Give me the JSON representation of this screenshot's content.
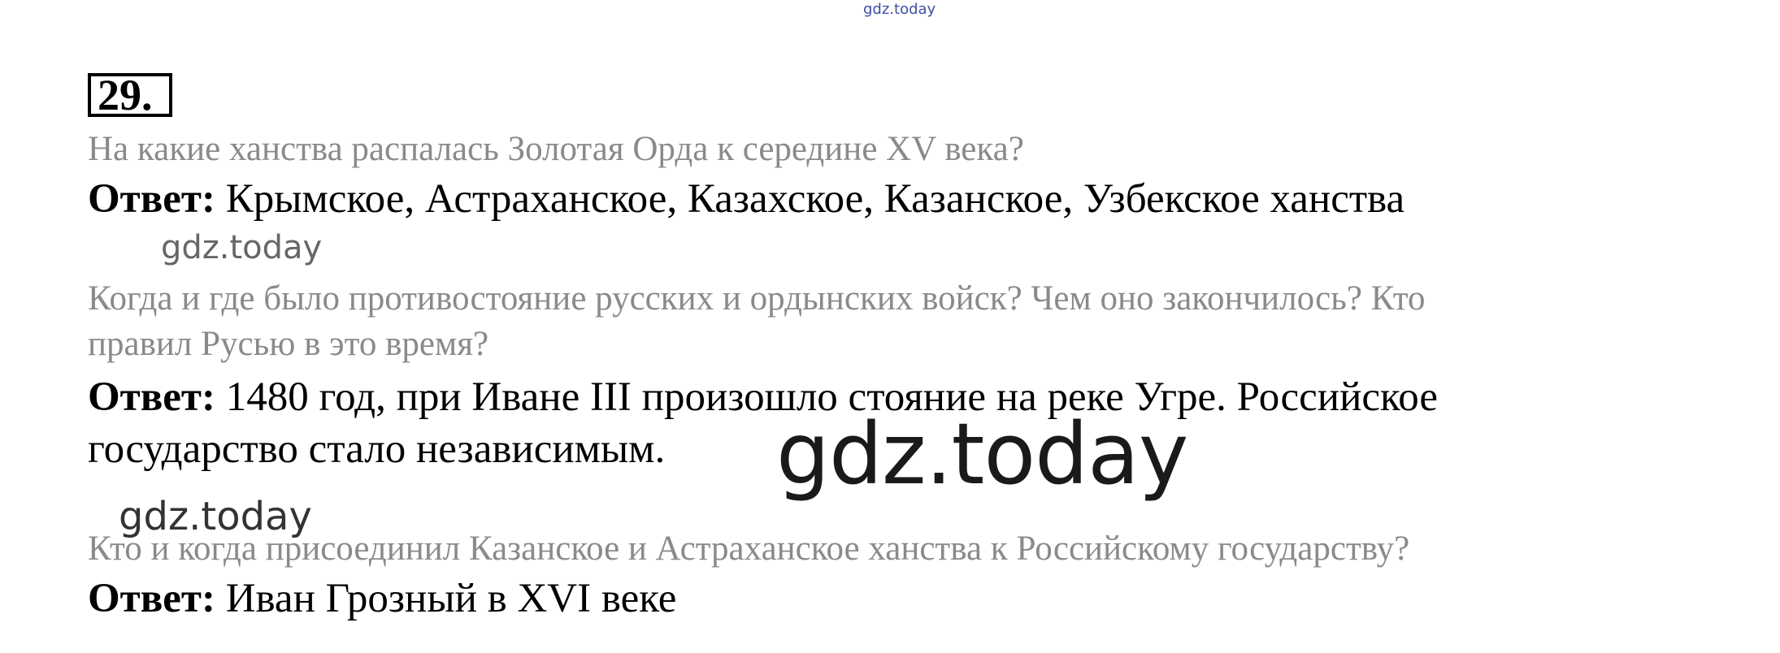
{
  "watermark_top": "gdz.today",
  "task_number": "29.",
  "questions": [
    "На какие ханства распалась Золотая Орда к середине XV века?",
    "Когда и где было противостояние русских и ордынских войск? Чем оно закончилось? Кто",
    "правил Русью в это время?",
    "Кто и когда присоединил Казанское и Астраханское ханства к Российскому государству?"
  ],
  "answer_label": "Ответ:",
  "answers": [
    "Крымское, Астраханское, Казахское, Казанское, Узбекское ханства",
    "1480 год, при Иване III произошло стояние на реке Угре. Российское",
    "государство стало независимым.",
    "Иван Грозный в XVI веке"
  ],
  "watermarks": [
    "gdz.today",
    "gdz.today",
    "gdz.today"
  ]
}
